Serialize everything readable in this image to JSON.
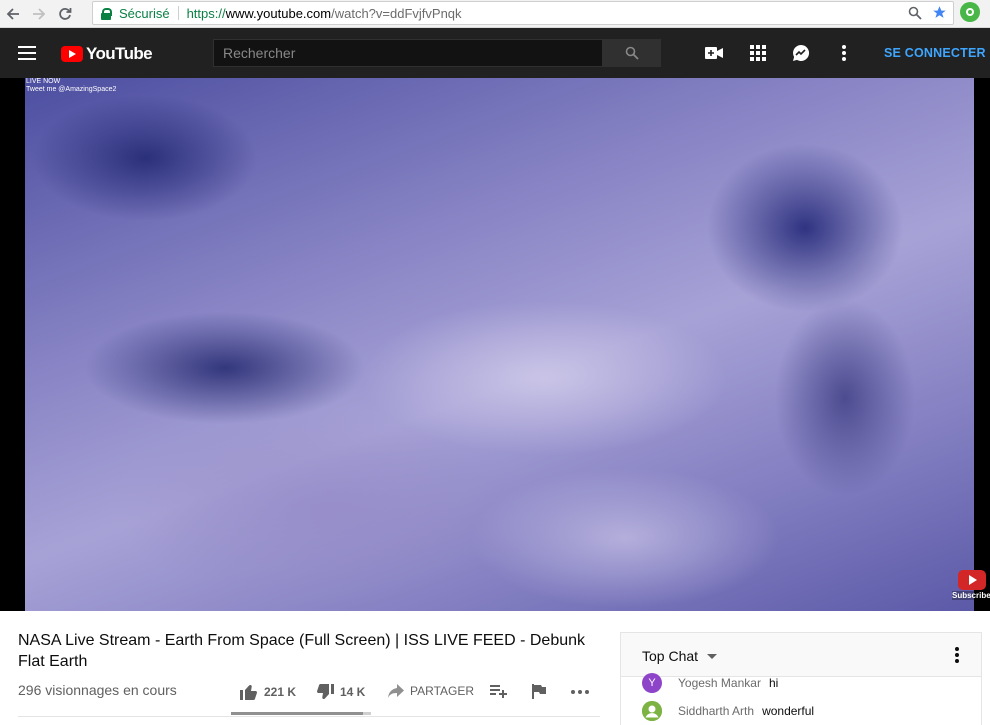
{
  "browser": {
    "secure_label": "Sécurisé",
    "url_scheme": "https://",
    "url_host": "www.youtube.com",
    "url_path": "/watch?v=ddFvjfvPnqk"
  },
  "masthead": {
    "logo_text": "YouTube",
    "search_placeholder": "Rechercher",
    "signin_label": "SE CONNECTER"
  },
  "player": {
    "overlay_line1": "LIVE NOW",
    "overlay_line2": "Tweet me @AmazingSpace2",
    "subscribe_label": "Subscribe"
  },
  "video": {
    "title": "NASA Live Stream - Earth From Space (Full Screen) | ISS LIVE FEED - Debunk Flat Earth",
    "views": "296 visionnages en cours",
    "likes": "221 K",
    "dislikes": "14 K",
    "share_label": "PARTAGER",
    "like_ratio": 0.94
  },
  "chat": {
    "title": "Top Chat",
    "messages": [
      {
        "initial": "Y",
        "author": "Yogesh Mankar",
        "text": "hi",
        "avatar_color": "#8e44c9"
      },
      {
        "initial": "",
        "author": "Siddharth Arth",
        "text": "wonderful",
        "avatar_color": "#7cb342"
      }
    ]
  },
  "colors": {
    "accent_red": "#ff0000",
    "link_blue": "#3ea6ff",
    "secure_green": "#0b8043"
  }
}
